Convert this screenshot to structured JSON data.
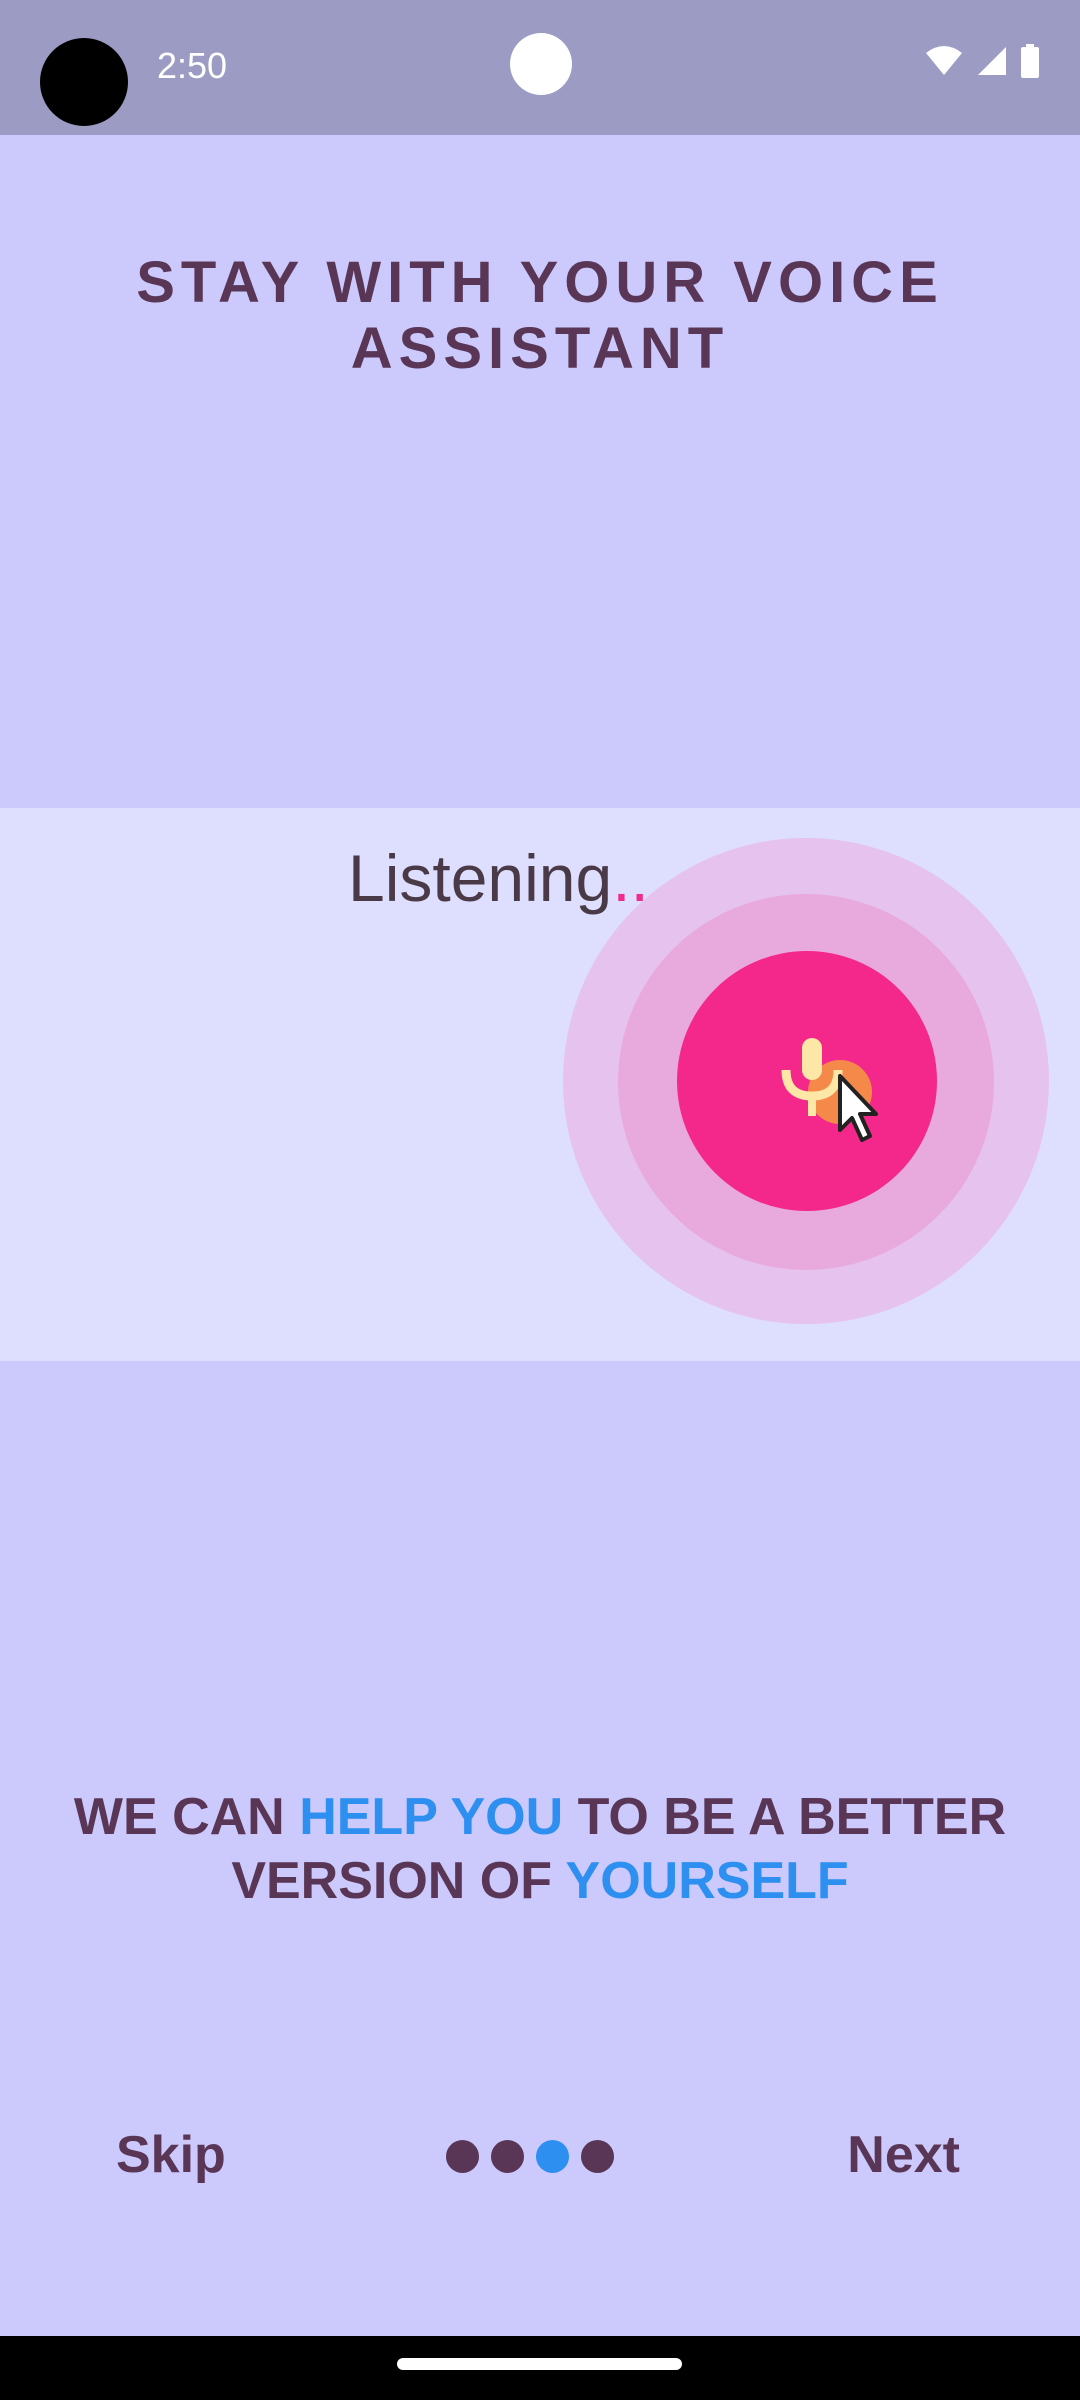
{
  "status_bar": {
    "time": "2:50",
    "icons": [
      "wifi-icon",
      "signal-icon",
      "battery-icon"
    ]
  },
  "onboarding": {
    "title": "STAY WITH YOUR VOICE ASSISTANT",
    "listening_text": "Listening",
    "listening_dots": "...",
    "tagline_parts": [
      {
        "text": "WE CAN ",
        "highlight": false
      },
      {
        "text": "HELP YOU",
        "highlight": true
      },
      {
        "text": " TO BE A BETTER VERSION OF ",
        "highlight": false
      },
      {
        "text": "YOURSELF",
        "highlight": true
      }
    ],
    "skip_label": "Skip",
    "next_label": "Next",
    "page_indicator": {
      "total": 4,
      "active": 3
    }
  },
  "colors": {
    "background": "#ccc9fc",
    "text": "#5a3656",
    "accent": "#2d8ff0",
    "mic_button": "#f4278a"
  }
}
